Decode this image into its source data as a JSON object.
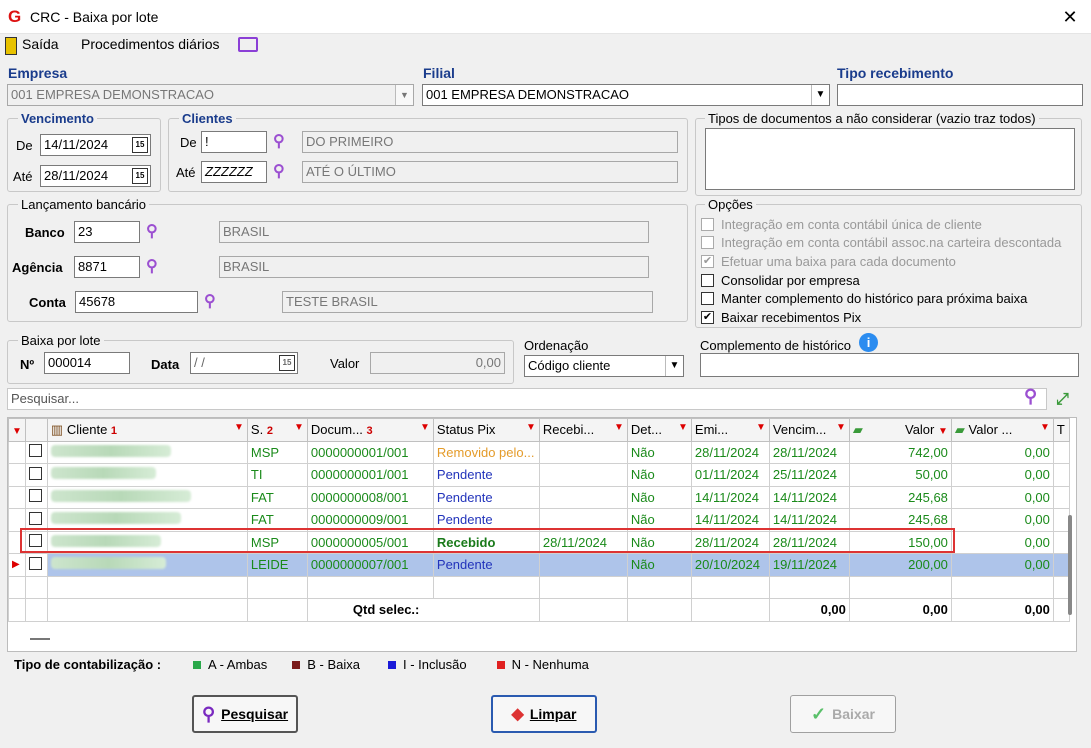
{
  "window": {
    "title": "CRC - Baixa por lote",
    "close": "✕"
  },
  "menu": {
    "exit": "Saída",
    "daily": "Procedimentos diários"
  },
  "empresa": {
    "label": "Empresa",
    "value": "001 EMPRESA DEMONSTRACAO"
  },
  "filial": {
    "label": "Filial",
    "value": "001 EMPRESA DEMONSTRACAO"
  },
  "tipo_recebimento": {
    "label": "Tipo recebimento",
    "value": ""
  },
  "vencimento": {
    "label": "Vencimento",
    "de_label": "De",
    "de": "14/11/2024",
    "ate_label": "Até",
    "ate": "28/11/2024"
  },
  "clientes": {
    "label": "Clientes",
    "de_label": "De",
    "de": "!",
    "de_desc": "DO PRIMEIRO",
    "ate_label": "Até",
    "ate": "ZZZZZZ",
    "ate_desc": "ATÉ O ÚLTIMO"
  },
  "tipos_doc": {
    "label": "Tipos de documentos a não considerar (vazio traz todos)"
  },
  "lancamento": {
    "label": "Lançamento bancário",
    "banco_label": "Banco",
    "banco": "23",
    "banco_desc": "BRASIL",
    "agencia_label": "Agência",
    "agencia": "8871",
    "agencia_desc": "BRASIL",
    "conta_label": "Conta",
    "conta": "45678",
    "conta_desc": "TESTE BRASIL"
  },
  "opcoes": {
    "label": "Opções",
    "items": [
      {
        "label": "Integração em conta contábil única de cliente",
        "checked": false,
        "enabled": false
      },
      {
        "label": "Integração em conta contábil assoc.na carteira descontada",
        "checked": false,
        "enabled": false
      },
      {
        "label": "Efetuar uma baixa para cada documento",
        "checked": true,
        "enabled": false
      },
      {
        "label": "Consolidar por empresa",
        "checked": false,
        "enabled": true
      },
      {
        "label": "Manter complemento do histórico para próxima baixa",
        "checked": false,
        "enabled": true
      },
      {
        "label": "Baixar recebimentos Pix",
        "checked": true,
        "enabled": true
      }
    ]
  },
  "baixa": {
    "label": "Baixa por lote",
    "n_label": "Nº",
    "n": "000014",
    "data_label": "Data",
    "data": " / /",
    "valor_label": "Valor",
    "valor": "0,00"
  },
  "ordenacao": {
    "label": "Ordenação",
    "value": "Código cliente"
  },
  "complemento": {
    "label": "Complemento de histórico",
    "value": ""
  },
  "search": {
    "placeholder": "Pesquisar..."
  },
  "grid": {
    "headers": [
      "Cliente",
      "S.",
      "Docum...",
      "Status Pix",
      "Recebi...",
      "Det...",
      "Emi...",
      "Vencim...",
      "Valor",
      "Valor ...",
      "T"
    ],
    "sort_marks": {
      "cliente": "1",
      "s": "2",
      "doc": "3"
    },
    "rows": [
      {
        "s": "MSP",
        "doc": "0000000001/001",
        "status": "Removido pelo...",
        "status_class": "orange",
        "recebido": "",
        "det": "Não",
        "emi": "28/11/2024",
        "venc": "28/11/2024",
        "valor": "742,00",
        "valor2": "0,00"
      },
      {
        "s": "TI",
        "doc": "0000000001/001",
        "status": "Pendente",
        "status_class": "blue",
        "recebido": "",
        "det": "Não",
        "emi": "01/11/2024",
        "venc": "25/11/2024",
        "valor": "50,00",
        "valor2": "0,00"
      },
      {
        "s": "FAT",
        "doc": "0000000008/001",
        "status": "Pendente",
        "status_class": "blue",
        "recebido": "",
        "det": "Não",
        "emi": "14/11/2024",
        "venc": "14/11/2024",
        "valor": "245,68",
        "valor2": "0,00"
      },
      {
        "s": "FAT",
        "doc": "0000000009/001",
        "status": "Pendente",
        "status_class": "blue",
        "recebido": "",
        "det": "Não",
        "emi": "14/11/2024",
        "venc": "14/11/2024",
        "valor": "245,68",
        "valor2": "0,00"
      },
      {
        "s": "MSP",
        "doc": "0000000005/001",
        "status": "Recebido",
        "status_class": "green-bold",
        "recebido": "28/11/2024",
        "det": "Não",
        "emi": "28/11/2024",
        "venc": "28/11/2024",
        "valor": "150,00",
        "valor2": "0,00"
      },
      {
        "s": "LEIDE",
        "doc": "0000000007/001",
        "status": "Pendente",
        "status_class": "blue",
        "recebido": "",
        "det": "Não",
        "emi": "20/10/2024",
        "venc": "19/11/2024",
        "valor": "200,00",
        "valor2": "0,00"
      }
    ],
    "footer": {
      "label": "Qtd selec.:",
      "venc": "0,00",
      "valor": "0,00",
      "valor2": "0,00"
    }
  },
  "legend": {
    "title": "Tipo de contabilização :",
    "items": [
      {
        "label": "A - Ambas",
        "color": "#2aa84a"
      },
      {
        "label": "B - Baixa",
        "color": "#7a1a1a"
      },
      {
        "label": "I - Inclusão",
        "color": "#1a1ad8"
      },
      {
        "label": "N - Nenhuma",
        "color": "#e02020"
      }
    ]
  },
  "buttons": {
    "pesquisar": "Pesquisar",
    "limpar": "Limpar",
    "baixar": "Baixar"
  }
}
